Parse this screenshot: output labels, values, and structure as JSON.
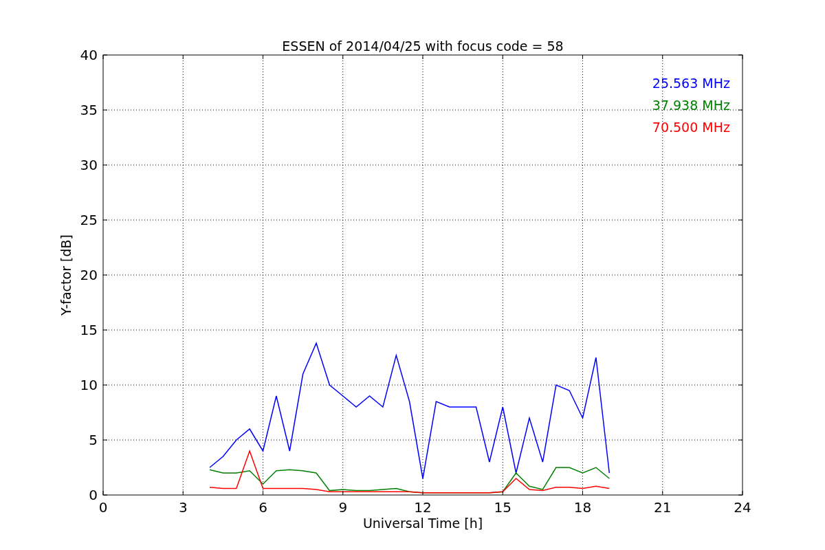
{
  "plot": {
    "chart_data": {
      "type": "line",
      "title": "ESSEN of 2014/04/25 with focus code = 58",
      "xlabel": "Universal Time [h]",
      "ylabel": "Y-factor [dB]",
      "x": [
        4,
        4.5,
        5,
        5.5,
        6,
        6.5,
        7,
        7.5,
        8,
        8.5,
        9,
        9.5,
        10,
        10.5,
        11,
        11.5,
        12,
        12.5,
        13,
        13.5,
        14,
        14.5,
        15,
        15.5,
        16,
        16.5,
        17,
        17.5,
        18,
        18.5,
        19
      ],
      "series": [
        {
          "name": "25.563 MHz",
          "color": "#0000ff",
          "values": [
            2.5,
            3.5,
            5,
            6,
            4,
            9,
            4,
            11,
            13.8,
            10,
            9,
            8,
            9,
            8,
            12.7,
            8.5,
            1.5,
            8.5,
            8,
            8,
            8,
            3,
            8,
            2,
            7,
            3,
            10,
            9.5,
            7,
            12.5,
            2
          ]
        },
        {
          "name": "37.938 MHz",
          "color": "#008000",
          "values": [
            2.3,
            2,
            2,
            2.2,
            1,
            2.2,
            2.3,
            2.2,
            2,
            0.4,
            0.5,
            0.4,
            0.4,
            0.5,
            0.6,
            0.3,
            0.2,
            0.2,
            0.2,
            0.2,
            0.2,
            0.2,
            0.3,
            2,
            0.8,
            0.5,
            2.5,
            2.5,
            2,
            2.5,
            1.5
          ]
        },
        {
          "name": "70.500 MHz",
          "color": "#ff0000",
          "values": [
            0.7,
            0.6,
            0.6,
            4,
            0.6,
            0.6,
            0.6,
            0.6,
            0.5,
            0.3,
            0.3,
            0.3,
            0.3,
            0.3,
            0.3,
            0.3,
            0.2,
            0.2,
            0.2,
            0.2,
            0.2,
            0.2,
            0.3,
            1.5,
            0.5,
            0.4,
            0.7,
            0.7,
            0.6,
            0.8,
            0.6
          ]
        }
      ],
      "grid": true,
      "xlim": [
        0,
        24
      ],
      "ylim": [
        0,
        40
      ],
      "xticks": [
        0,
        3,
        6,
        9,
        12,
        15,
        18,
        21,
        24
      ],
      "yticks": [
        0,
        5,
        10,
        15,
        20,
        25,
        30,
        35,
        40
      ]
    }
  }
}
